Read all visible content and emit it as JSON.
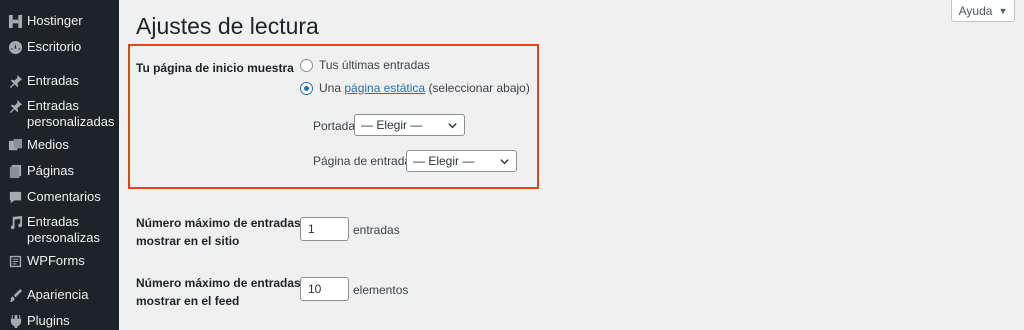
{
  "sidebar": {
    "items": [
      {
        "icon": "hostinger-icon",
        "label": "Hostinger"
      },
      {
        "icon": "dashboard-icon",
        "label": "Escritorio"
      },
      {
        "icon": "pin-icon",
        "label": "Entradas"
      },
      {
        "icon": "pin-icon",
        "label": "Entradas personalizadas"
      },
      {
        "icon": "media-icon",
        "label": "Medios"
      },
      {
        "icon": "pages-icon",
        "label": "Páginas"
      },
      {
        "icon": "comments-icon",
        "label": "Comentarios"
      },
      {
        "icon": "music-icon",
        "label": "Entradas personalizas"
      },
      {
        "icon": "forms-icon",
        "label": "WPForms"
      },
      {
        "icon": "appearance-icon",
        "label": "Apariencia"
      },
      {
        "icon": "plugins-icon",
        "label": "Plugins"
      }
    ]
  },
  "header": {
    "title": "Ajustes de lectura",
    "help_label": "Ayuda",
    "help_caret": "▼"
  },
  "homepage": {
    "label": "Tu página de inicio muestra",
    "option_latest": "Tus últimas entradas",
    "option_static_prefix": "Una",
    "option_static_link": "página estática",
    "option_static_suffix": "(seleccionar abajo)",
    "selected": "static",
    "front_page_label": "Portada:",
    "front_page_value": "— Elegir —",
    "posts_page_label": "Página de entradas:",
    "posts_page_value": "— Elegir —"
  },
  "posts_per_page": {
    "label_line1": "Número máximo de entradas a",
    "label_line2": "mostrar en el sitio",
    "value": "1",
    "unit": "entradas"
  },
  "feed_items": {
    "label_line1": "Número máximo de entradas a",
    "label_line2": "mostrar en el feed",
    "value": "10",
    "unit": "elementos"
  },
  "colors": {
    "sidebar_bg": "#1d2327",
    "highlight": "#e8401c",
    "accent": "#2271b1"
  }
}
